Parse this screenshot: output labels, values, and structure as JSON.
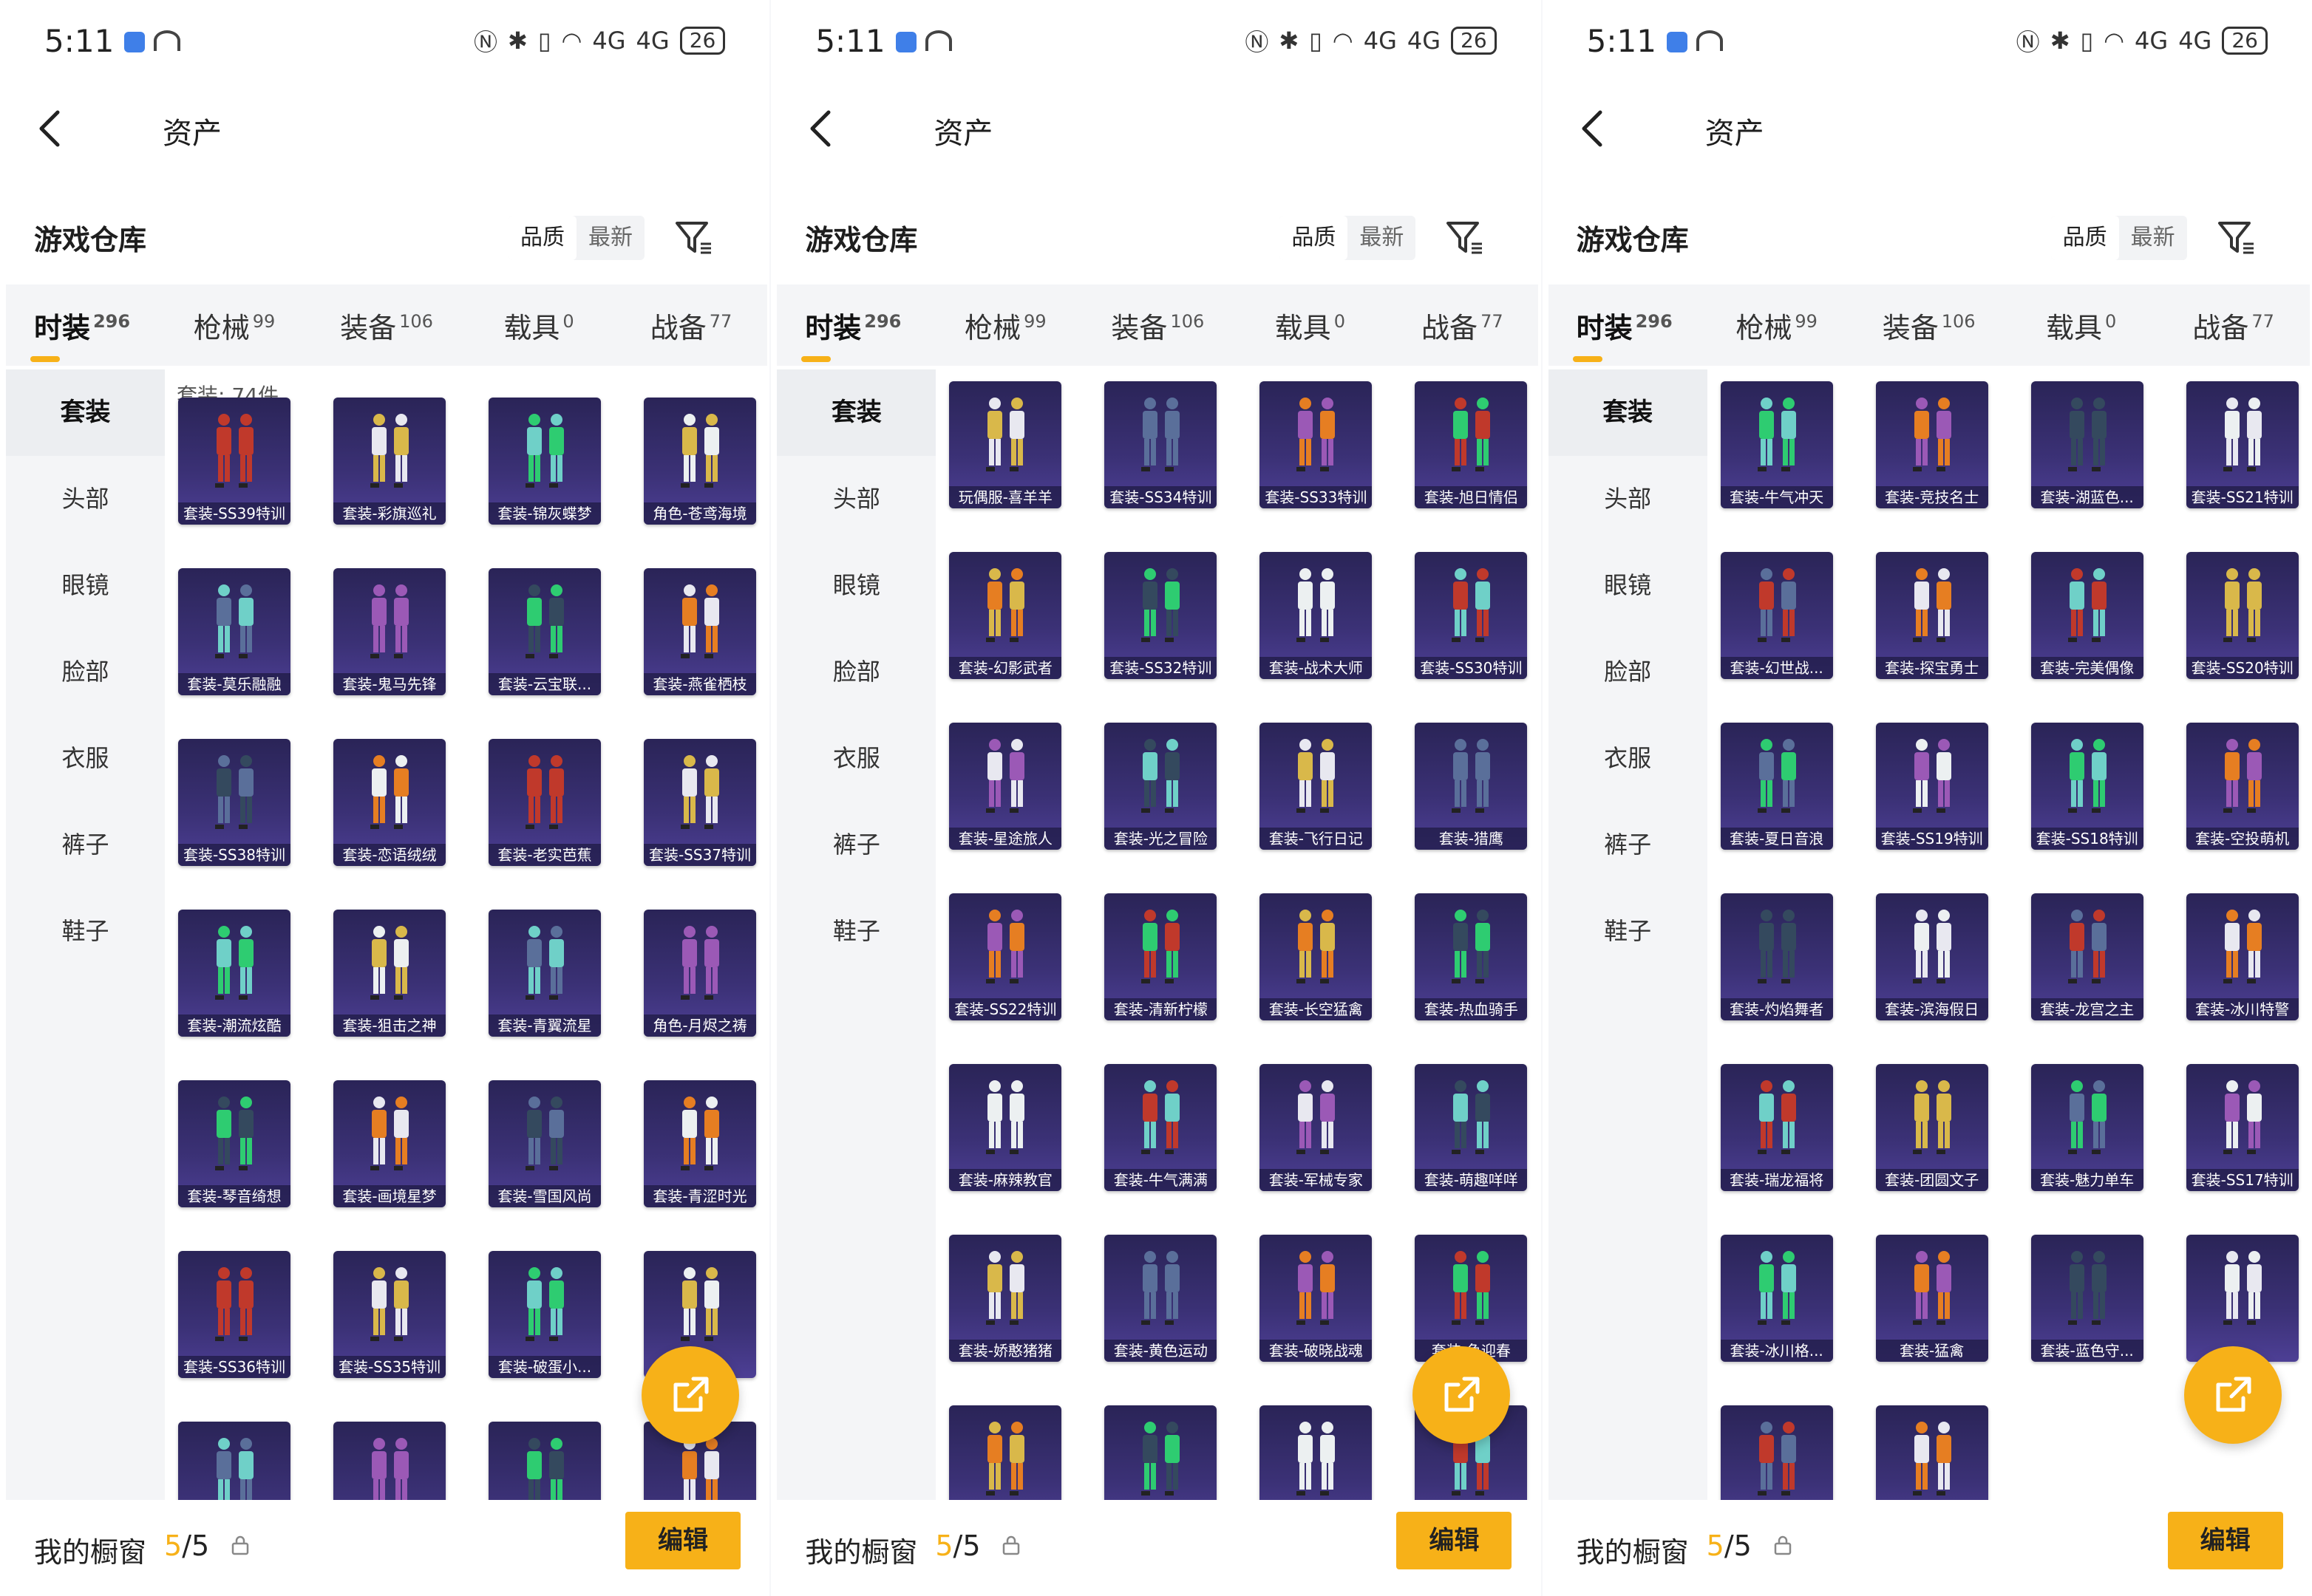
{
  "accent_color": "#f7b118",
  "panels": [
    {
      "status": {
        "time": "5:11",
        "battery": "26",
        "net": "4G"
      },
      "title": "资产",
      "section_title": "游戏仓库",
      "sort": [
        "品质",
        "最新"
      ],
      "tabs": [
        {
          "label": "时装",
          "count": "296"
        },
        {
          "label": "枪械",
          "count": "99"
        },
        {
          "label": "装备",
          "count": "106"
        },
        {
          "label": "载具",
          "count": "0"
        },
        {
          "label": "战备",
          "count": "77"
        }
      ],
      "side": [
        "套装",
        "头部",
        "眼镜",
        "脸部",
        "衣服",
        "裤子",
        "鞋子"
      ],
      "count_label": "套装: 74件",
      "items": [
        "套装-SS39特训",
        "套装-彩旗巡礼",
        "套装-锦灰蝶梦",
        "角色-苍鸢海境",
        "套装-莫乐融融",
        "套装-鬼马先锋",
        "套装-云宝联...",
        "套装-燕雀栖枝",
        "套装-SS38特训",
        "套装-恋语绒绒",
        "套装-老实芭蕉",
        "套装-SS37特训",
        "套装-潮流炫酷",
        "套装-狙击之神",
        "套装-青翼流星",
        "角色-月烬之祷",
        "套装-琴音绮想",
        "套装-画境星梦",
        "套装-雪国风尚",
        "套装-青涩时光",
        "套装-SS36特训",
        "套装-SS35特训",
        "套装-破蛋小...",
        "",
        "",
        "",
        "",
        ""
      ],
      "showcase_label": "我的橱窗",
      "showcase_current": "5",
      "showcase_total": "/5",
      "edit_label": "编辑"
    },
    {
      "status": {
        "time": "5:11",
        "battery": "26",
        "net": "4G"
      },
      "title": "资产",
      "section_title": "游戏仓库",
      "sort": [
        "品质",
        "最新"
      ],
      "tabs": [
        {
          "label": "时装",
          "count": "296"
        },
        {
          "label": "枪械",
          "count": "99"
        },
        {
          "label": "装备",
          "count": "106"
        },
        {
          "label": "载具",
          "count": "0"
        },
        {
          "label": "战备",
          "count": "77"
        }
      ],
      "side": [
        "套装",
        "头部",
        "眼镜",
        "脸部",
        "衣服",
        "裤子",
        "鞋子"
      ],
      "count_label": "",
      "items": [
        "玩偶服-喜羊羊",
        "套装-SS34特训",
        "套装-SS33特训",
        "套装-旭日情侣",
        "套装-幻影武者",
        "套装-SS32特训",
        "套装-战术大师",
        "套装-SS30特训",
        "套装-星途旅人",
        "套装-光之冒险",
        "套装-飞行日记",
        "套装-猎鹰",
        "套装-SS22特训",
        "套装-清新柠檬",
        "套装-长空猛禽",
        "套装-热血骑手",
        "套装-麻辣教官",
        "套装-牛气满满",
        "套装-军械专家",
        "套装-萌趣咩咩",
        "套装-娇憨猪猪",
        "套装-黄色运动",
        "套装-破晓战魂",
        "套装-鱼迎春",
        "",
        "",
        "",
        ""
      ],
      "showcase_label": "我的橱窗",
      "showcase_current": "5",
      "showcase_total": "/5",
      "edit_label": "编辑"
    },
    {
      "status": {
        "time": "5:11",
        "battery": "26",
        "net": "4G"
      },
      "title": "资产",
      "section_title": "游戏仓库",
      "sort": [
        "品质",
        "最新"
      ],
      "tabs": [
        {
          "label": "时装",
          "count": "296"
        },
        {
          "label": "枪械",
          "count": "99"
        },
        {
          "label": "装备",
          "count": "106"
        },
        {
          "label": "载具",
          "count": "0"
        },
        {
          "label": "战备",
          "count": "77"
        }
      ],
      "side": [
        "套装",
        "头部",
        "眼镜",
        "脸部",
        "衣服",
        "裤子",
        "鞋子"
      ],
      "count_label": "",
      "items": [
        "套装-牛气冲天",
        "套装-竞技名士",
        "套装-湖蓝色...",
        "套装-SS21特训",
        "套装-幻世战...",
        "套装-探宝勇士",
        "套装-完美偶像",
        "套装-SS20特训",
        "套装-夏日音浪",
        "套装-SS19特训",
        "套装-SS18特训",
        "套装-空投萌机",
        "套装-灼焰舞者",
        "套装-滨海假日",
        "套装-龙宫之主",
        "套装-冰川特警",
        "套装-瑞龙福将",
        "套装-团圆文子",
        "套装-魅力单车",
        "套装-SS17特训",
        "套装-冰川格...",
        "套装-猛禽",
        "套装-蓝色守...",
        "",
        "",
        ""
      ],
      "showcase_label": "我的橱窗",
      "showcase_current": "5",
      "showcase_total": "/5",
      "edit_label": "编辑"
    }
  ]
}
